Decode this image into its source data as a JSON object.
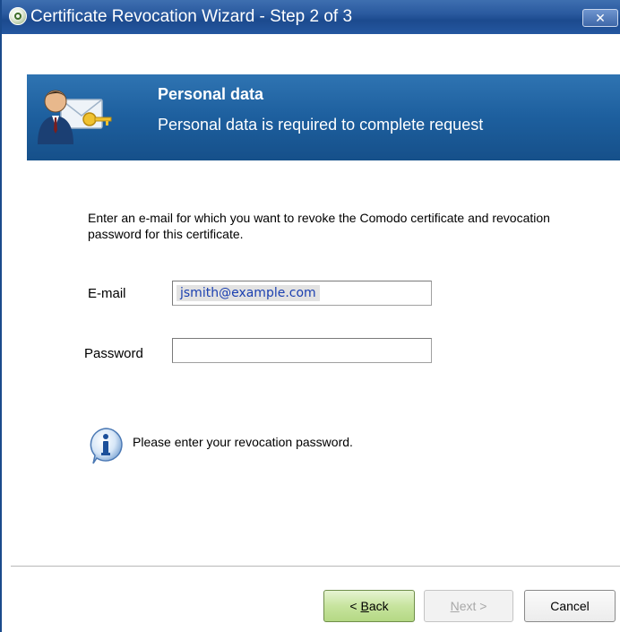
{
  "window": {
    "title": "Certificate Revocation Wizard - Step 2 of 3",
    "close_label": "✕"
  },
  "banner": {
    "title": "Personal data",
    "subtitle": "Personal data is required to complete request"
  },
  "form": {
    "instructions": "Enter an e-mail for which you want to revoke the Comodo certificate and revocation password for this certificate.",
    "email_label": "E-mail",
    "email_value": "jsmith@example.com",
    "password_label": "Password",
    "password_value": ""
  },
  "info": {
    "message": "Please enter your revocation password."
  },
  "buttons": {
    "back_prefix": "< ",
    "back_access": "B",
    "back_rest": "ack",
    "next_access": "N",
    "next_rest": "ext >",
    "cancel": "Cancel"
  },
  "colors": {
    "titlebar": "#1c4a8e",
    "banner": "#1d5f9e",
    "back_button": "#c7e49e"
  }
}
